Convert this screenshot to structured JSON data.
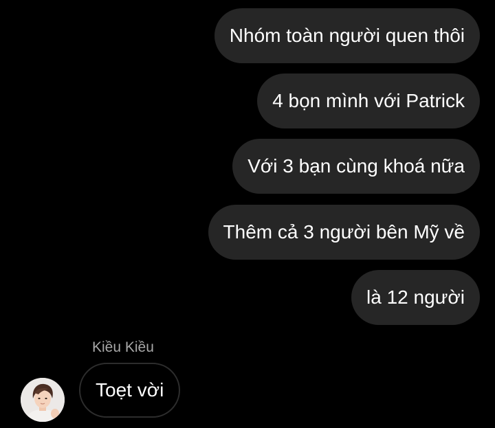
{
  "conversation": {
    "sent_messages": [
      "Nhóm toàn người quen thôi",
      "4 bọn mình với Patrick",
      "Với 3 bạn cùng khoá nữa",
      "Thêm cả 3 người bên Mỹ về",
      "là 12 người"
    ],
    "received": {
      "sender_name": "Kiều Kiều",
      "message": "Toẹt vời",
      "avatar_icon": "profile-photo"
    }
  },
  "colors": {
    "background": "#000000",
    "sent_bubble": "#262626",
    "received_bubble_border": "#2d2d2d",
    "text": "#ffffff",
    "sender_name": "#a8a8a8"
  }
}
